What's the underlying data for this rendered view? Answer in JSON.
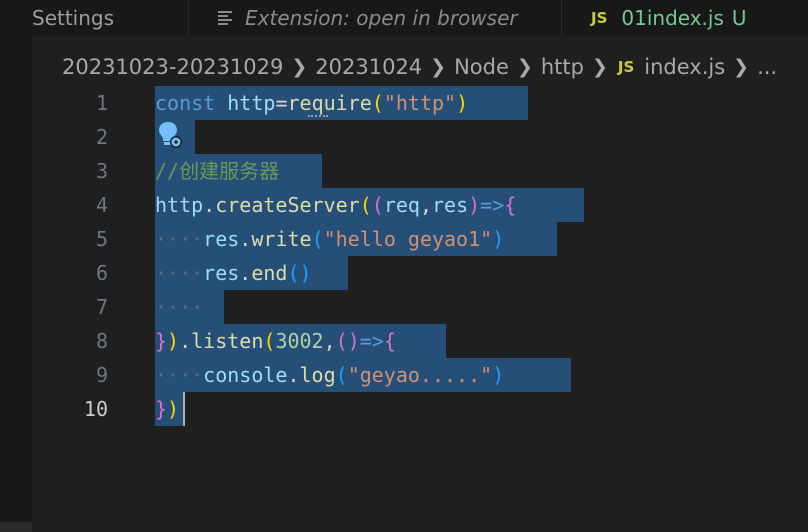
{
  "tabs": [
    {
      "label": "Settings"
    },
    {
      "label": "Extension: open in browser"
    },
    {
      "badge": "JS",
      "label": "01index.js",
      "status": "U"
    }
  ],
  "breadcrumb": {
    "parts": [
      "20231023-20231029",
      "20231024",
      "Node",
      "http"
    ],
    "file_badge": "JS",
    "file": "index.js",
    "more": "..."
  },
  "editor": {
    "line_numbers": [
      "1",
      "2",
      "3",
      "4",
      "5",
      "6",
      "7",
      "8",
      "9",
      "10"
    ],
    "active_line": "10",
    "code": {
      "l1": {
        "kw": "const",
        "var": "http",
        "eq": "=",
        "fn": "require",
        "open": "(",
        "str": "\"http\"",
        "close": ")"
      },
      "l3": {
        "comment": "//创建服务器"
      },
      "l4": {
        "obj": "http",
        "dot": ".",
        "fn": "createServer",
        "open1": "(",
        "open2": "(",
        "p1": "req",
        "comma": ",",
        "p2": "res",
        "close2": ")",
        "arrow": "=>",
        "brace": "{"
      },
      "l5": {
        "indent": "····",
        "obj": "res",
        "dot": ".",
        "fn": "write",
        "open": "(",
        "str": "\"hello geyao1\"",
        "close": ")"
      },
      "l6": {
        "indent": "····",
        "obj": "res",
        "dot": ".",
        "fn": "end",
        "open": "(",
        "close": ")"
      },
      "l7": {
        "indent": "····"
      },
      "l8": {
        "brace": "}",
        "close": ")",
        "dot": ".",
        "fn": "listen",
        "open": "(",
        "num": "3002",
        "comma": ",",
        "popen": "(",
        "pclose": ")",
        "arrow": "=>",
        "brace2": "{"
      },
      "l9": {
        "indent": "····",
        "obj": "console",
        "dot": ".",
        "fn": "log",
        "open": "(",
        "str": "\"geyao.....\"",
        "close": ")"
      },
      "l10": {
        "brace": "}",
        "close": ")"
      }
    }
  },
  "colors": {
    "selection": "#264f78",
    "keyword": "#569cd6",
    "function": "#dcdcaa",
    "string": "#ce9178",
    "comment": "#6a9955",
    "untracked": "#73c991"
  }
}
